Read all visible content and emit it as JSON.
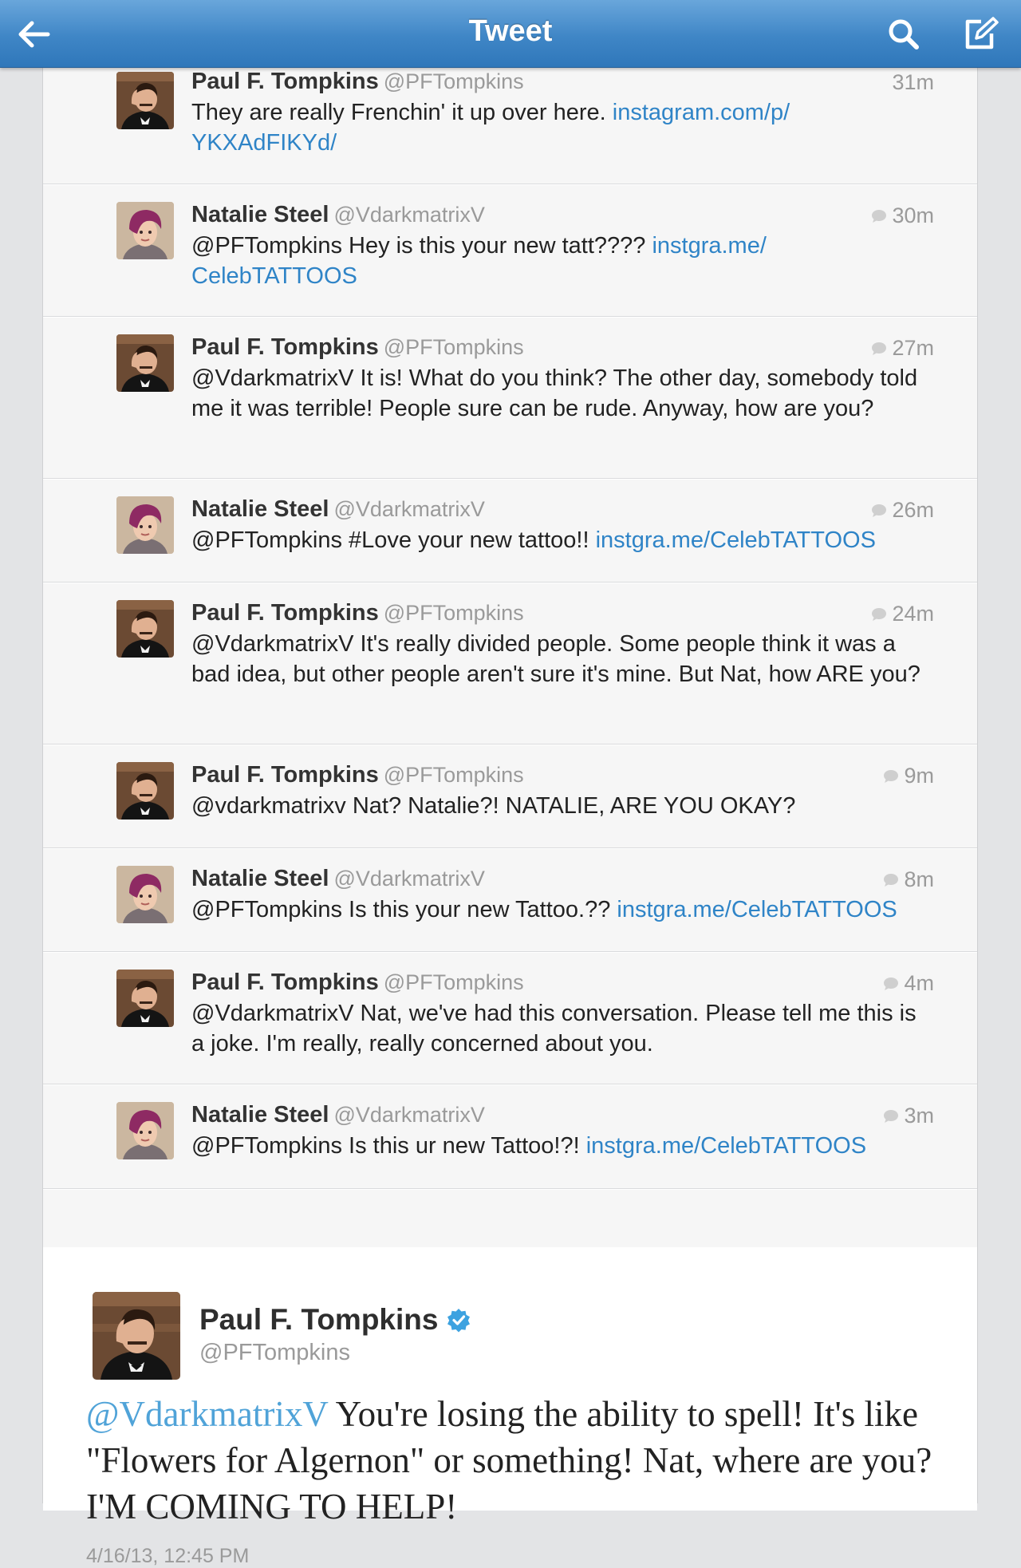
{
  "nav": {
    "title": "Tweet",
    "back_icon": "arrow-left-icon",
    "search_icon": "search-icon",
    "compose_icon": "compose-icon"
  },
  "colors": {
    "nav_blue": "#3f86c6",
    "link_blue": "#2f84c7",
    "verified_blue": "#3da2e0"
  },
  "conversation": [
    {
      "name": "Paul F. Tompkins",
      "handle": "@PFTompkins",
      "time": "31m",
      "reply_icon": false,
      "text": "They are really Frenchin' it up over here. ",
      "link": "instagram.com/p/YKXAdFIKYd/",
      "link_line1": "instagram.com/p/",
      "link_line2": "YKXAdFIKYd/",
      "avatar": "paul"
    },
    {
      "name": "Natalie Steel",
      "handle": "@VdarkmatrixV",
      "time": "30m",
      "reply_icon": true,
      "text": "@PFTompkins Hey is this your new tatt???? ",
      "link_line1": "instgra.me/",
      "link_line2": "CelebTATTOOS",
      "avatar": "natalie"
    },
    {
      "name": "Paul F. Tompkins",
      "handle": "@PFTompkins",
      "time": "27m",
      "reply_icon": true,
      "text": "@VdarkmatrixV It is! What do you think? The other day, somebody told me it was terrible! People sure can be rude. Anyway, how are you?",
      "avatar": "paul"
    },
    {
      "name": "Natalie Steel",
      "handle": "@VdarkmatrixV",
      "time": "26m",
      "reply_icon": true,
      "text": "@PFTompkins #Love your new tattoo!! ",
      "link": "instgra.me/CelebTATTOOS",
      "avatar": "natalie"
    },
    {
      "name": "Paul F. Tompkins",
      "handle": "@PFTompkins",
      "time": "24m",
      "reply_icon": true,
      "text": "@VdarkmatrixV It's really divided people. Some people think it was a bad idea, but other people aren't sure it's mine. But Nat, how ARE you?",
      "avatar": "paul"
    },
    {
      "name": "Paul F. Tompkins",
      "handle": "@PFTompkins",
      "time": "9m",
      "reply_icon": true,
      "text": "@vdarkmatrixv Nat? Natalie?! NATALIE, ARE YOU OKAY?",
      "avatar": "paul"
    },
    {
      "name": "Natalie Steel",
      "handle": "@VdarkmatrixV",
      "time": "8m",
      "reply_icon": true,
      "text": "@PFTompkins Is this your new Tattoo.?? ",
      "link": "instgra.me/CelebTATTOOS",
      "avatar": "natalie"
    },
    {
      "name": "Paul F. Tompkins",
      "handle": "@PFTompkins",
      "time": "4m",
      "reply_icon": true,
      "text": "@VdarkmatrixV Nat, we've had this conversation. Please tell me this is a joke.  I'm really, really concerned about you.",
      "avatar": "paul"
    },
    {
      "name": "Natalie Steel",
      "handle": "@VdarkmatrixV",
      "time": "3m",
      "reply_icon": true,
      "text": "@PFTompkins Is this ur new Tattoo!?! ",
      "link": "instgra.me/CelebTATTOOS",
      "avatar": "natalie"
    }
  ],
  "main_tweet": {
    "name": "Paul F. Tompkins",
    "handle": "@PFTompkins",
    "verified": true,
    "mention": "@VdarkmatrixV",
    "text": " You're losing the ability to spell! It's like \"Flowers for Algernon\" or something! Nat, where are you? I'M COMING TO HELP!",
    "date": "4/16/13, 12:45 PM"
  }
}
